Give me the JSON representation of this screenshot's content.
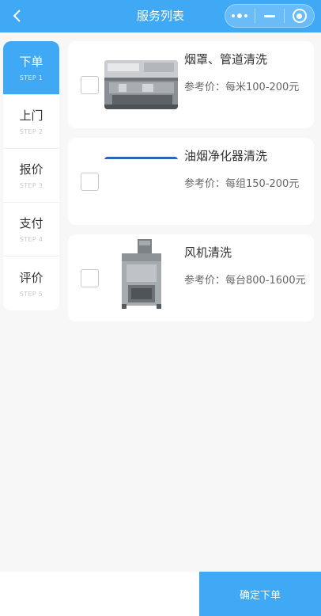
{
  "header": {
    "title": "服务列表",
    "back_icon": "chevron-left-icon",
    "capsule_icons": [
      "more-dots-icon",
      "minimize-icon",
      "close-circle-icon"
    ],
    "color": "#3fa9f5"
  },
  "steps": [
    {
      "label": "下单",
      "sub": "STEP 1",
      "active": true
    },
    {
      "label": "上门",
      "sub": "STEP 2",
      "active": false
    },
    {
      "label": "报价",
      "sub": "STEP 3",
      "active": false
    },
    {
      "label": "支付",
      "sub": "STEP 4",
      "active": false
    },
    {
      "label": "评价",
      "sub": "STEP 5",
      "active": false
    }
  ],
  "services": [
    {
      "name": "烟罩、管道清洗",
      "price": "参考价：每米100-200元",
      "checked": false,
      "image": "commercial-kitchen-photo"
    },
    {
      "name": "油烟净化器清洗",
      "price": "参考价：每组150-200元",
      "checked": false,
      "image": "purifier-photo"
    },
    {
      "name": "风机清洗",
      "price": "参考价：每台800-1600元",
      "checked": false,
      "image": "fan-unit-photo"
    }
  ],
  "footer": {
    "confirm_label": "确定下单"
  }
}
